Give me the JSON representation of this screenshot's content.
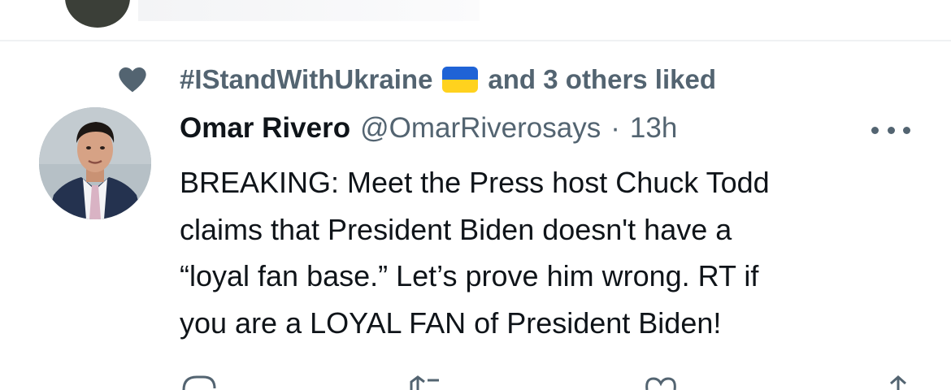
{
  "context": {
    "liker": "#IStandWithUkraine",
    "suffix": "and 3 others liked",
    "flag_icon": "ukraine-flag-icon"
  },
  "tweet": {
    "name": "Omar Rivero",
    "handle": "@OmarRiverosays",
    "separator": "·",
    "time": "13h",
    "lines": [
      "BREAKING: Meet the Press host Chuck Todd",
      "claims that President Biden doesn't have a",
      "“loyal fan base.” Let’s prove him wrong. RT if",
      "you are a LOYAL FAN of President Biden!"
    ]
  },
  "icons": {
    "heart": "heart-icon",
    "more": "more-icon",
    "reply": "reply-icon",
    "retweet": "retweet-icon",
    "like": "like-icon",
    "share": "share-icon"
  },
  "colors": {
    "secondary_text": "#536471",
    "primary_text": "#0f1419",
    "flag_blue": "#1f63d6",
    "flag_yellow": "#ffd21e"
  }
}
